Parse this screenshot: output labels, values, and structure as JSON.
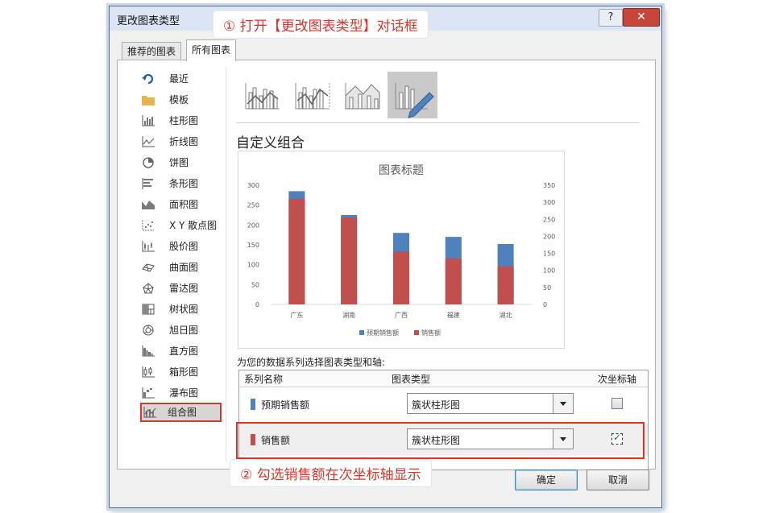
{
  "dialog": {
    "title": "更改图表类型",
    "help_label": "?",
    "close_label": "✕",
    "tabs": [
      {
        "label": "推荐的图表"
      },
      {
        "label": "所有图表"
      }
    ]
  },
  "sidebar": {
    "items": [
      {
        "label": "最近"
      },
      {
        "label": "模板"
      },
      {
        "label": "柱形图"
      },
      {
        "label": "折线图"
      },
      {
        "label": "饼图"
      },
      {
        "label": "条形图"
      },
      {
        "label": "面积图"
      },
      {
        "label": "X Y 散点图"
      },
      {
        "label": "股价图"
      },
      {
        "label": "曲面图"
      },
      {
        "label": "雷达图"
      },
      {
        "label": "树状图"
      },
      {
        "label": "旭日图"
      },
      {
        "label": "直方图"
      },
      {
        "label": "箱形图"
      },
      {
        "label": "瀑布图"
      },
      {
        "label": "组合图"
      }
    ],
    "selected_index": 16
  },
  "main": {
    "section_title": "自定义组合",
    "prompt": "为您的数据系列选择图表类型和轴:",
    "table": {
      "headers": [
        "系列名称",
        "图表类型",
        "次坐标轴"
      ],
      "rows": [
        {
          "name": "预期销售额",
          "chart_type": "簇状柱形图",
          "secondary_axis": false,
          "color": "#4f81bd"
        },
        {
          "name": "销售额",
          "chart_type": "簇状柱形图",
          "secondary_axis": true,
          "color": "#c0504d"
        }
      ]
    }
  },
  "buttons": {
    "ok": "确定",
    "cancel": "取消"
  },
  "annotations": {
    "step1": "① 打开【更改图表类型】对话框",
    "step2": "② 勾选销售额在次坐标轴显示"
  },
  "chart_data": {
    "type": "bar",
    "title": "图表标题",
    "categories": [
      "广东",
      "湖南",
      "广西",
      "福建",
      "湖北"
    ],
    "series": [
      {
        "name": "预期销售额",
        "values": [
          285,
          225,
          180,
          170,
          152
        ],
        "color": "#4f81bd",
        "axis": "primary"
      },
      {
        "name": "销售额",
        "values": [
          310,
          255,
          155,
          135,
          112
        ],
        "color": "#c0504d",
        "axis": "secondary"
      }
    ],
    "ylim_primary": [
      0,
      300
    ],
    "yticks_primary": [
      "0",
      "50",
      "100",
      "150",
      "200",
      "250",
      "300"
    ],
    "ylim_secondary": [
      0,
      350
    ],
    "yticks_secondary": [
      "0",
      "50",
      "100",
      "150",
      "200",
      "250",
      "300",
      "350"
    ],
    "legend": "bottom",
    "grid": false
  }
}
